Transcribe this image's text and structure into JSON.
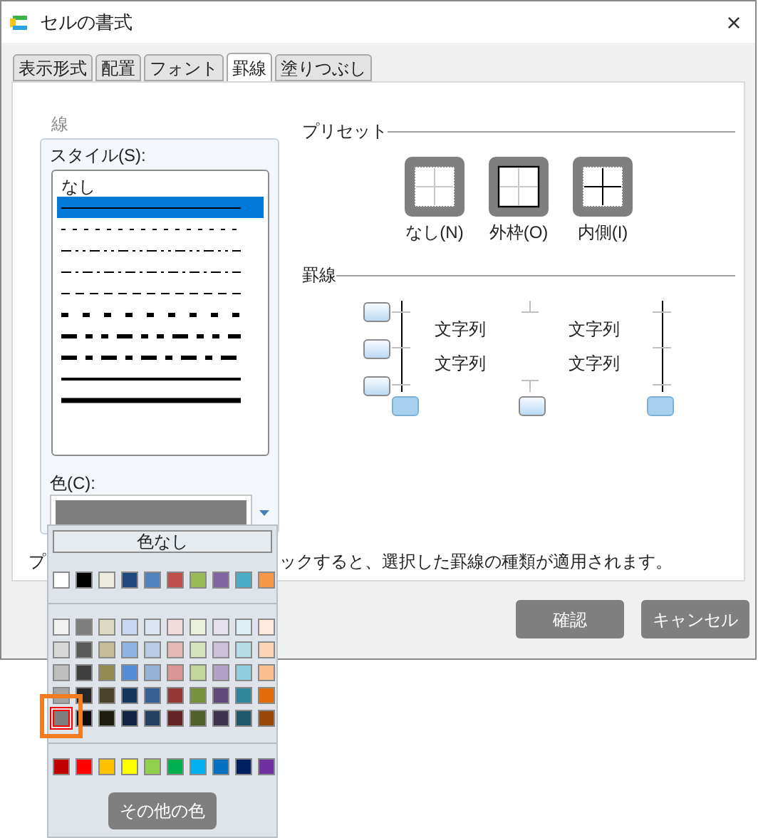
{
  "window": {
    "title": "セルの書式",
    "close": "×"
  },
  "tabs": [
    {
      "label": "表示形式",
      "selected": false
    },
    {
      "label": "配置",
      "selected": false
    },
    {
      "label": "フォント",
      "selected": false
    },
    {
      "label": "罫線",
      "selected": true
    },
    {
      "label": "塗りつぶし",
      "selected": false
    }
  ],
  "line_group": {
    "title": "線",
    "style_label": "スタイル(S):",
    "color_label": "色(C):",
    "styles": [
      {
        "kind": "none",
        "label": "なし",
        "selected": false
      },
      {
        "kind": "thin",
        "selected": true
      },
      {
        "kind": "hair",
        "selected": false
      },
      {
        "kind": "dashdotdot",
        "selected": false
      },
      {
        "kind": "dashdot",
        "selected": false
      },
      {
        "kind": "dashed",
        "selected": false
      },
      {
        "kind": "mediumdashed",
        "selected": false
      },
      {
        "kind": "mediumdashdotdot",
        "selected": false
      },
      {
        "kind": "mediumdashdot",
        "selected": false
      },
      {
        "kind": "medium",
        "selected": false
      },
      {
        "kind": "thick",
        "selected": false
      }
    ]
  },
  "presets": {
    "title": "プリセット",
    "items": [
      {
        "kind": "none",
        "label": "なし(N)"
      },
      {
        "kind": "outline",
        "label": "外枠(O)"
      },
      {
        "kind": "inside",
        "label": "内側(I)"
      }
    ]
  },
  "borders": {
    "title": "罫線",
    "sample_texts": [
      "文字列",
      "文字列",
      "文字列",
      "文字列"
    ],
    "buttons": [
      {
        "kind": "top",
        "on": false
      },
      {
        "kind": "middle",
        "on": false
      },
      {
        "kind": "bottom",
        "on": false
      },
      {
        "kind": "left",
        "on": true
      },
      {
        "kind": "center",
        "on": false
      },
      {
        "kind": "right",
        "on": true
      }
    ]
  },
  "hint": {
    "start": "プ",
    "rest": "ックすると、選択した罫線の種類が適用されます。"
  },
  "buttons": [
    "確認",
    "キャンセル"
  ],
  "color_popup": {
    "no_color": "色なし",
    "more_colors": "その他の色",
    "standard_row": [
      {
        "color": "#ffffff",
        "selected": false
      },
      {
        "color": "#000000",
        "selected": false
      },
      {
        "color": "#eeece1",
        "selected": false
      },
      {
        "color": "#1f497d",
        "selected": false
      },
      {
        "color": "#4f81bd",
        "selected": false
      },
      {
        "color": "#c0504d",
        "selected": false
      },
      {
        "color": "#9bbb59",
        "selected": false
      },
      {
        "color": "#8064a2",
        "selected": false
      },
      {
        "color": "#4bacc6",
        "selected": false
      },
      {
        "color": "#f79646",
        "selected": false
      }
    ],
    "theme_rows": [
      {
        "swatches": [
          {
            "color": "#f2f2f2",
            "selected": false
          },
          {
            "color": "#7f7f7f",
            "selected": false
          },
          {
            "color": "#ddd9c3",
            "selected": false
          },
          {
            "color": "#c6d9f0",
            "selected": false
          },
          {
            "color": "#dbe5f1",
            "selected": false
          },
          {
            "color": "#f2dcdb",
            "selected": false
          },
          {
            "color": "#ebf1dd",
            "selected": false
          },
          {
            "color": "#e5e0ec",
            "selected": false
          },
          {
            "color": "#dbeef3",
            "selected": false
          },
          {
            "color": "#fdeada",
            "selected": false
          }
        ]
      },
      {
        "swatches": [
          {
            "color": "#d8d8d8",
            "selected": false
          },
          {
            "color": "#595959",
            "selected": false
          },
          {
            "color": "#c4bd97",
            "selected": false
          },
          {
            "color": "#8db3e2",
            "selected": false
          },
          {
            "color": "#b8cce4",
            "selected": false
          },
          {
            "color": "#e5b9b7",
            "selected": false
          },
          {
            "color": "#d7e3bc",
            "selected": false
          },
          {
            "color": "#ccc1d9",
            "selected": false
          },
          {
            "color": "#b7dde8",
            "selected": false
          },
          {
            "color": "#fbd5b5",
            "selected": false
          }
        ]
      },
      {
        "swatches": [
          {
            "color": "#bfbfbf",
            "selected": false
          },
          {
            "color": "#3f3f3f",
            "selected": false
          },
          {
            "color": "#938953",
            "selected": false
          },
          {
            "color": "#548dd4",
            "selected": false
          },
          {
            "color": "#95b3d7",
            "selected": false
          },
          {
            "color": "#d99694",
            "selected": false
          },
          {
            "color": "#c3d69b",
            "selected": false
          },
          {
            "color": "#b2a2c7",
            "selected": false
          },
          {
            "color": "#92cddc",
            "selected": false
          },
          {
            "color": "#fac08f",
            "selected": false
          }
        ]
      },
      {
        "swatches": [
          {
            "color": "#a5a5a5",
            "selected": false
          },
          {
            "color": "#262626",
            "selected": false
          },
          {
            "color": "#494429",
            "selected": false
          },
          {
            "color": "#17365d",
            "selected": false
          },
          {
            "color": "#366092",
            "selected": false
          },
          {
            "color": "#953734",
            "selected": false
          },
          {
            "color": "#76923c",
            "selected": false
          },
          {
            "color": "#5f497a",
            "selected": false
          },
          {
            "color": "#31859b",
            "selected": false
          },
          {
            "color": "#e36c09",
            "selected": false
          }
        ]
      },
      {
        "swatches": [
          {
            "color": "#7f7f7f",
            "selected": true
          },
          {
            "color": "#0c0c0c",
            "selected": false
          },
          {
            "color": "#1d1b10",
            "selected": false
          },
          {
            "color": "#0f243e",
            "selected": false
          },
          {
            "color": "#244061",
            "selected": false
          },
          {
            "color": "#632423",
            "selected": false
          },
          {
            "color": "#4f6128",
            "selected": false
          },
          {
            "color": "#3f3151",
            "selected": false
          },
          {
            "color": "#205867",
            "selected": false
          },
          {
            "color": "#974806",
            "selected": false
          }
        ]
      }
    ],
    "bright_row": [
      {
        "color": "#c00000",
        "selected": false
      },
      {
        "color": "#ff0000",
        "selected": false
      },
      {
        "color": "#ffc000",
        "selected": false
      },
      {
        "color": "#ffff00",
        "selected": false
      },
      {
        "color": "#92d050",
        "selected": false
      },
      {
        "color": "#00b050",
        "selected": false
      },
      {
        "color": "#00b0f0",
        "selected": false
      },
      {
        "color": "#0070c0",
        "selected": false
      },
      {
        "color": "#002060",
        "selected": false
      },
      {
        "color": "#7030a0",
        "selected": false
      }
    ]
  }
}
